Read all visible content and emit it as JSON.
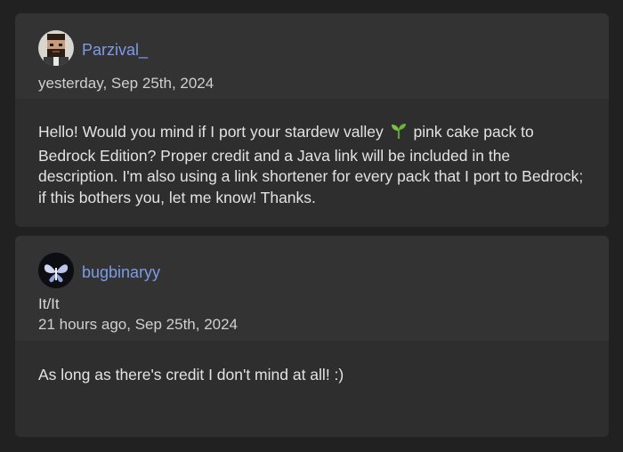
{
  "comments": [
    {
      "author": "Parzival_",
      "timestamp": "yesterday, Sep 25th, 2024",
      "body_before_emoji": "Hello! Would you mind if I port your stardew valley ",
      "emoji": "seedling-icon",
      "body_after_emoji": " pink cake pack to Bedrock Edition? Proper credit and a Java link will be included in the description. I'm also using a link shortener for every pack that I port to Bedrock; if this bothers you, let me know! Thanks."
    },
    {
      "author": "bugbinaryy",
      "pronouns": "It/It",
      "timestamp": "21 hours ago, Sep 25th, 2024",
      "body": "As long as there's credit I don't mind at all! :)"
    }
  ],
  "colors": {
    "background": "#212121",
    "card": "#2e2e2e",
    "card_header": "#333333",
    "username": "#7c9ce6",
    "text": "#e3e3e3"
  }
}
